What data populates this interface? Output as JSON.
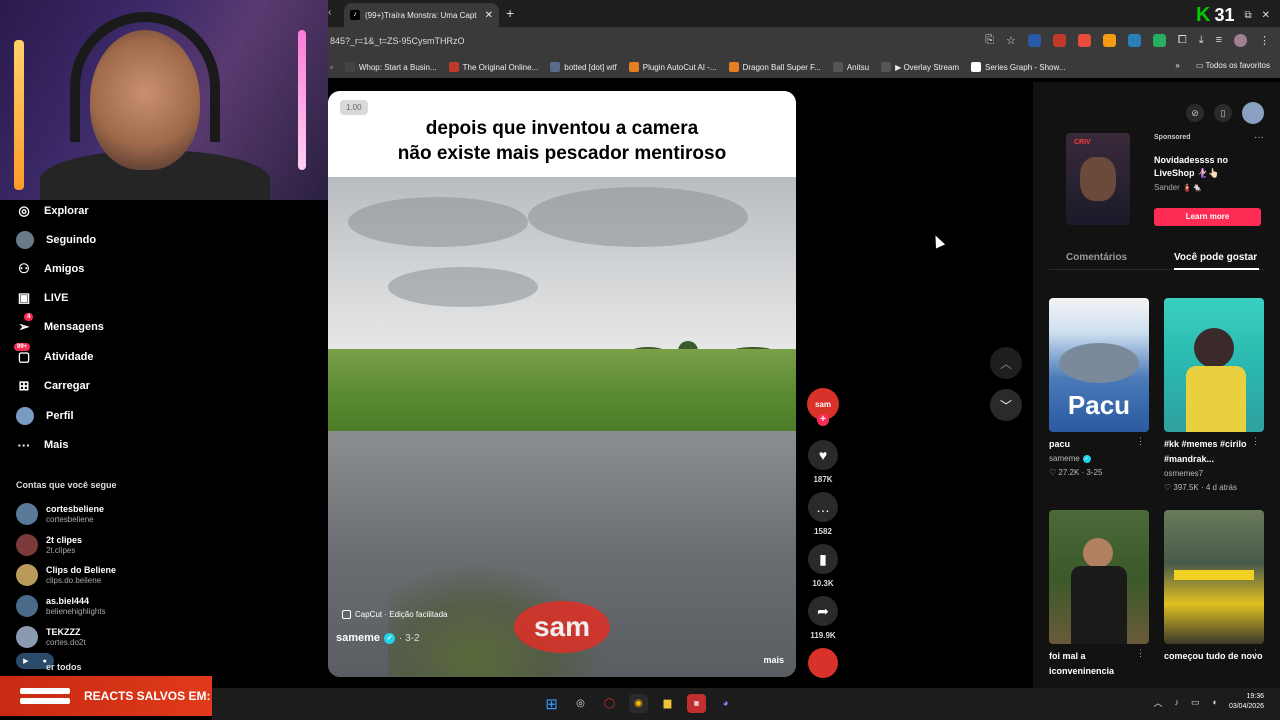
{
  "browser": {
    "tab_title": "(99+)Traíra Monstra: Uma Capt",
    "tab_favicon": "tiktok-icon",
    "new_tab": "+",
    "counter": "31",
    "url": "845?_r=1&_t=ZS-95CysmTHRzO",
    "bookmarks": [
      {
        "label": "Whop: Start a Busin...",
        "color": "#444"
      },
      {
        "label": "The Original Online...",
        "color": "#c0392b"
      },
      {
        "label": "botted [dot] wtf",
        "color": "#5a6a8a"
      },
      {
        "label": "Plugin AutoCut AI -...",
        "color": "#e67e22"
      },
      {
        "label": "Dragon Ball Super F...",
        "color": "#e67e22"
      },
      {
        "label": "Anitsu",
        "color": "#555"
      },
      {
        "label": "▶ Overlay Stream",
        "color": "#555"
      },
      {
        "label": "Series Graph - Show...",
        "color": "#fff"
      }
    ],
    "bookmarks_folder": "Todos os favoritos"
  },
  "nav": {
    "items": [
      {
        "label": "Explorar",
        "icon": "compass-icon"
      },
      {
        "label": "Seguindo",
        "icon": "avatar"
      },
      {
        "label": "Amigos",
        "icon": "friends-icon"
      },
      {
        "label": "LIVE",
        "icon": "live-icon"
      },
      {
        "label": "Mensagens",
        "icon": "message-icon",
        "badge": "4"
      },
      {
        "label": "Atividade",
        "icon": "activity-icon",
        "badge": "99+"
      },
      {
        "label": "Carregar",
        "icon": "upload-icon"
      },
      {
        "label": "Perfil",
        "icon": "avatar"
      },
      {
        "label": "Mais",
        "icon": "more-icon"
      }
    ],
    "following_title": "Contas que você segue",
    "accounts": [
      {
        "name": "cortesbeliene",
        "handle": "cortesbeliene",
        "color": "#5a7a9a"
      },
      {
        "name": "2t clipes",
        "handle": "2t.clipes",
        "color": "#7a3a3a"
      },
      {
        "name": "Clips do Beliene",
        "handle": "clips.do.beliene",
        "color": "#b89a5a"
      },
      {
        "name": "as.biel444",
        "handle": "belienehighlights",
        "color": "#4a6a8a"
      },
      {
        "name": "TEKZZZ",
        "handle": "cortes.do2t",
        "color": "#8a9ab0"
      }
    ],
    "see_all": "er todos"
  },
  "overlay": {
    "reacts_label": "REACTS SALVOS EM:"
  },
  "video": {
    "speed": "1.00",
    "caption_line1": "depois que inventou a camera",
    "caption_line2": "não existe mais pescador mentiroso",
    "watermark": "sam",
    "capcut": "CapCut · Edição facilitada",
    "author": "sameme",
    "date": "· 3-2",
    "more": "mais"
  },
  "actions": {
    "likes": "187K",
    "comments": "1582",
    "saves": "10.3K",
    "shares": "119.9K"
  },
  "right": {
    "sponsored": "Sponsored",
    "ad_title": "Novidadessss no LiveShop 🧜🏻‍♀️👆🏻",
    "ad_sub": "Sander 🧯🐁",
    "ad_thumb_label": "CRIV",
    "learn_more": "Learn more",
    "tab_comments": "Comentários",
    "tab_suggest": "Você pode gostar",
    "cards": [
      {
        "title": "pacu",
        "author": "sameme",
        "likes": "27.2K",
        "date": "3-25",
        "thumb_text": "Pacu",
        "verified": true
      },
      {
        "title": "#kk #memes #cirilo #mandrak...",
        "author": "osmemes7",
        "likes": "397.5K",
        "date": "4 d atrás",
        "thumb_text": "",
        "verified": false
      },
      {
        "title": "foi mal a iconveninencia",
        "author": "",
        "likes": "",
        "date": "",
        "thumb_text": "",
        "verified": false
      },
      {
        "title": "começou tudo de novo",
        "author": "",
        "likes": "",
        "date": "",
        "thumb_text": "",
        "verified": false
      }
    ]
  },
  "taskbar": {
    "time": "19:36",
    "date": "03/04/2026"
  }
}
